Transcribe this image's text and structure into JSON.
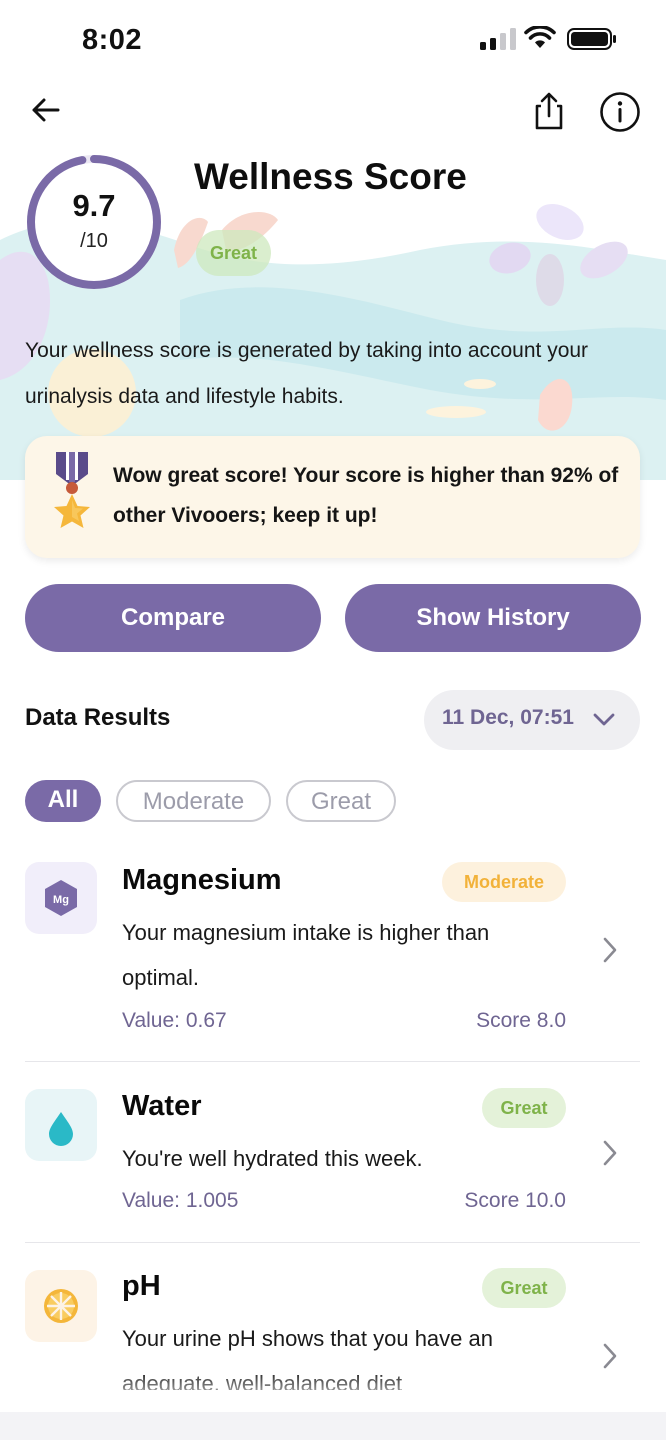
{
  "status_bar": {
    "time": "8:02"
  },
  "header": {
    "title": "Wellness Score"
  },
  "score": {
    "value": "9.7",
    "max": "/10",
    "fraction": 0.97,
    "grade": "Great"
  },
  "description": "Your wellness score is generated by taking into account your urinalysis data and lifestyle habits.",
  "callout": {
    "text": "Wow great score! Your score is higher than 92% of other Vivooers; keep it up!"
  },
  "actions": {
    "compare_label": "Compare",
    "history_label": "Show History"
  },
  "data_results": {
    "title": "Data Results",
    "date": "11 Dec, 07:51",
    "filters": [
      "All",
      "Moderate",
      "Great"
    ],
    "active_filter": "All",
    "items": [
      {
        "name": "Magnesium",
        "badge": "Moderate",
        "description": "Your magnesium intake is higher than optimal.",
        "value": "Value: 0.67",
        "score": "Score 8.0",
        "icon": "magnesium-icon"
      },
      {
        "name": "Water",
        "badge": "Great",
        "description": "You're well hydrated this week.",
        "value": "Value: 1.005",
        "score": "Score 10.0",
        "icon": "water-drop-icon"
      },
      {
        "name": "pH",
        "badge": "Great",
        "description": "Your urine pH shows that you have an adequate, well-balanced diet",
        "icon": "citrus-icon"
      }
    ]
  },
  "colors": {
    "primary": "#7a6aa7",
    "great": "#7fb34a",
    "moderate": "#f2b23a",
    "text_secondary": "#6f6592"
  }
}
